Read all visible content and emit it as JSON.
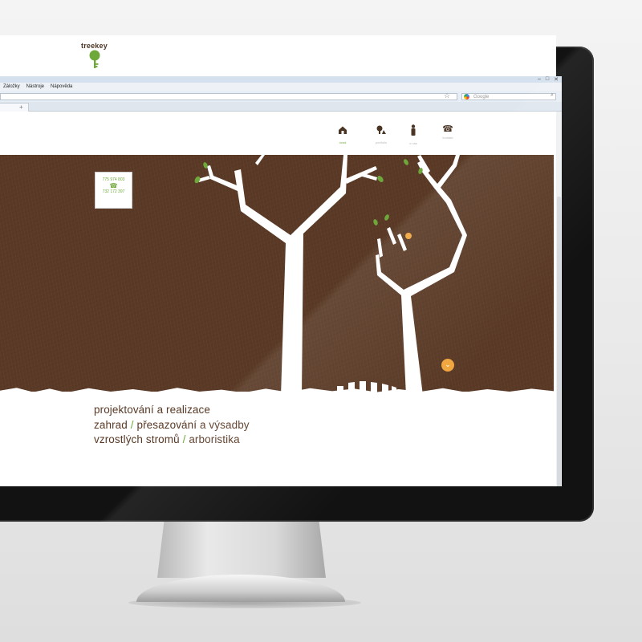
{
  "browser": {
    "window_controls": [
      "–",
      "□",
      "✕"
    ],
    "menu": [
      "Záložky",
      "Nástroje",
      "Nápověda"
    ],
    "search_placeholder": "Google",
    "new_tab": "+"
  },
  "site": {
    "logo": "treekey",
    "nav": [
      {
        "label": "úvod",
        "icon": "house-icon",
        "active": true
      },
      {
        "label": "portfolio",
        "icon": "tree-icon",
        "active": false
      },
      {
        "label": "o nás",
        "icon": "person-icon",
        "active": false
      },
      {
        "label": "kontakt",
        "icon": "phone-icon",
        "active": false
      }
    ],
    "phone_card": {
      "phone_1": "775 974 803",
      "phone_2": "732 172 397",
      "icon": "phone-icon"
    },
    "tagline": {
      "line_1": "projektování a realizace",
      "line_2_a": "zahrad",
      "separator": "/",
      "line_2_b": "přesazování a výsadby",
      "line_3_a": "vzrostlých stromů",
      "line_3_b": "arboristika"
    },
    "scroll_icon": "chevron-down-icon"
  },
  "colors": {
    "hero_brown": "#5a3a26",
    "accent_green": "#6fa83a",
    "accent_orange": "#f0a63d"
  }
}
